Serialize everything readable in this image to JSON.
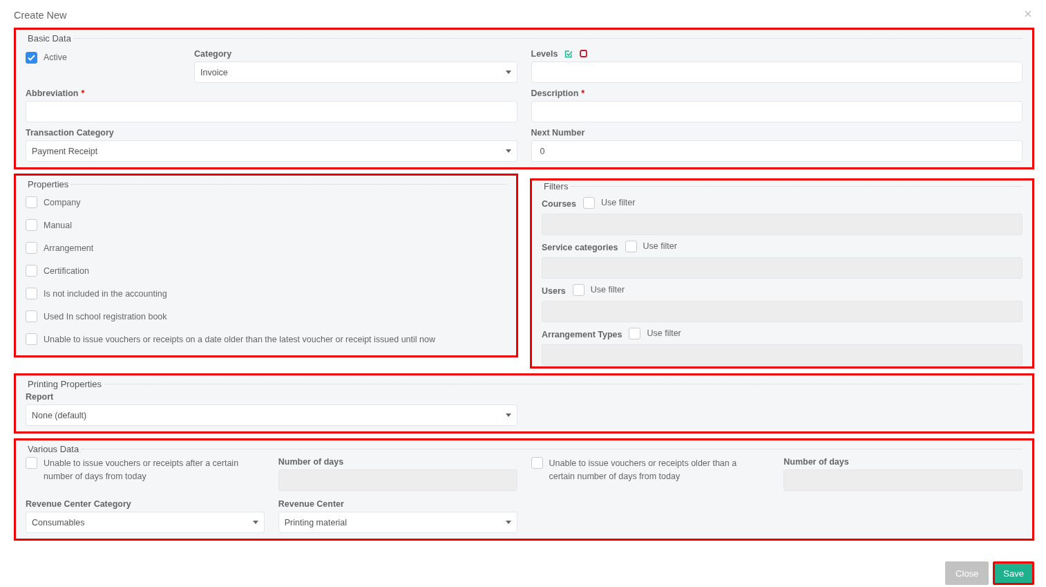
{
  "dialog": {
    "title": "Create New"
  },
  "basic_data": {
    "legend": "Basic Data",
    "highlighted": true,
    "active": {
      "label": "Active",
      "checked": true
    },
    "category": {
      "label": "Category",
      "value": "Invoice"
    },
    "levels": {
      "label": "Levels"
    },
    "abbreviation": {
      "label": "Abbreviation",
      "required_mark": "*"
    },
    "description": {
      "label": "Description",
      "required_mark": "*"
    },
    "transaction_category": {
      "label": "Transaction Category",
      "value": "Payment Receipt"
    },
    "next_number": {
      "label": "Next Number",
      "value": "0"
    }
  },
  "properties": {
    "legend": "Properties",
    "highlighted": true,
    "items": [
      {
        "label": "Company",
        "checked": false
      },
      {
        "label": "Manual",
        "checked": false
      },
      {
        "label": "Arrangement",
        "checked": false
      },
      {
        "label": "Certification",
        "checked": false
      },
      {
        "label": "Is not included in the accounting",
        "checked": false
      },
      {
        "label": "Used In school registration book",
        "checked": false
      },
      {
        "label": "Unable to issue vouchers or receipts on a date older than the latest voucher or receipt issued until now",
        "checked": false
      }
    ]
  },
  "filters": {
    "legend": "Filters",
    "highlighted": true,
    "items": [
      {
        "label": "Courses",
        "option": "Use filter",
        "checked": false
      },
      {
        "label": "Service categories",
        "option": "Use filter",
        "checked": false
      },
      {
        "label": "Users",
        "option": "Use filter",
        "checked": false
      },
      {
        "label": "Arrangement Types",
        "option": "Use filter",
        "checked": false
      }
    ]
  },
  "printing_properties": {
    "legend": "Printing Properties",
    "highlighted": true,
    "report": {
      "label": "Report",
      "value": "None (default)"
    }
  },
  "various_data": {
    "legend": "Various Data",
    "highlighted": true,
    "restrictions": [
      {
        "label": "Unable to issue vouchers or receipts after a certain number of days from today",
        "checked": false,
        "days_label": "Number of days"
      },
      {
        "label": "Unable to issue vouchers or receipts older than a certain number of days from today",
        "checked": false,
        "days_label": "Number of days"
      }
    ],
    "revenue_center_category": {
      "label": "Revenue Center Category",
      "value": "Consumables"
    },
    "revenue_center": {
      "label": "Revenue Center",
      "value": "Printing material"
    }
  },
  "buttons": [
    {
      "label": "Close",
      "kind": "close",
      "highlighted": false
    },
    {
      "label": "Save",
      "kind": "save",
      "highlighted": true
    }
  ]
}
